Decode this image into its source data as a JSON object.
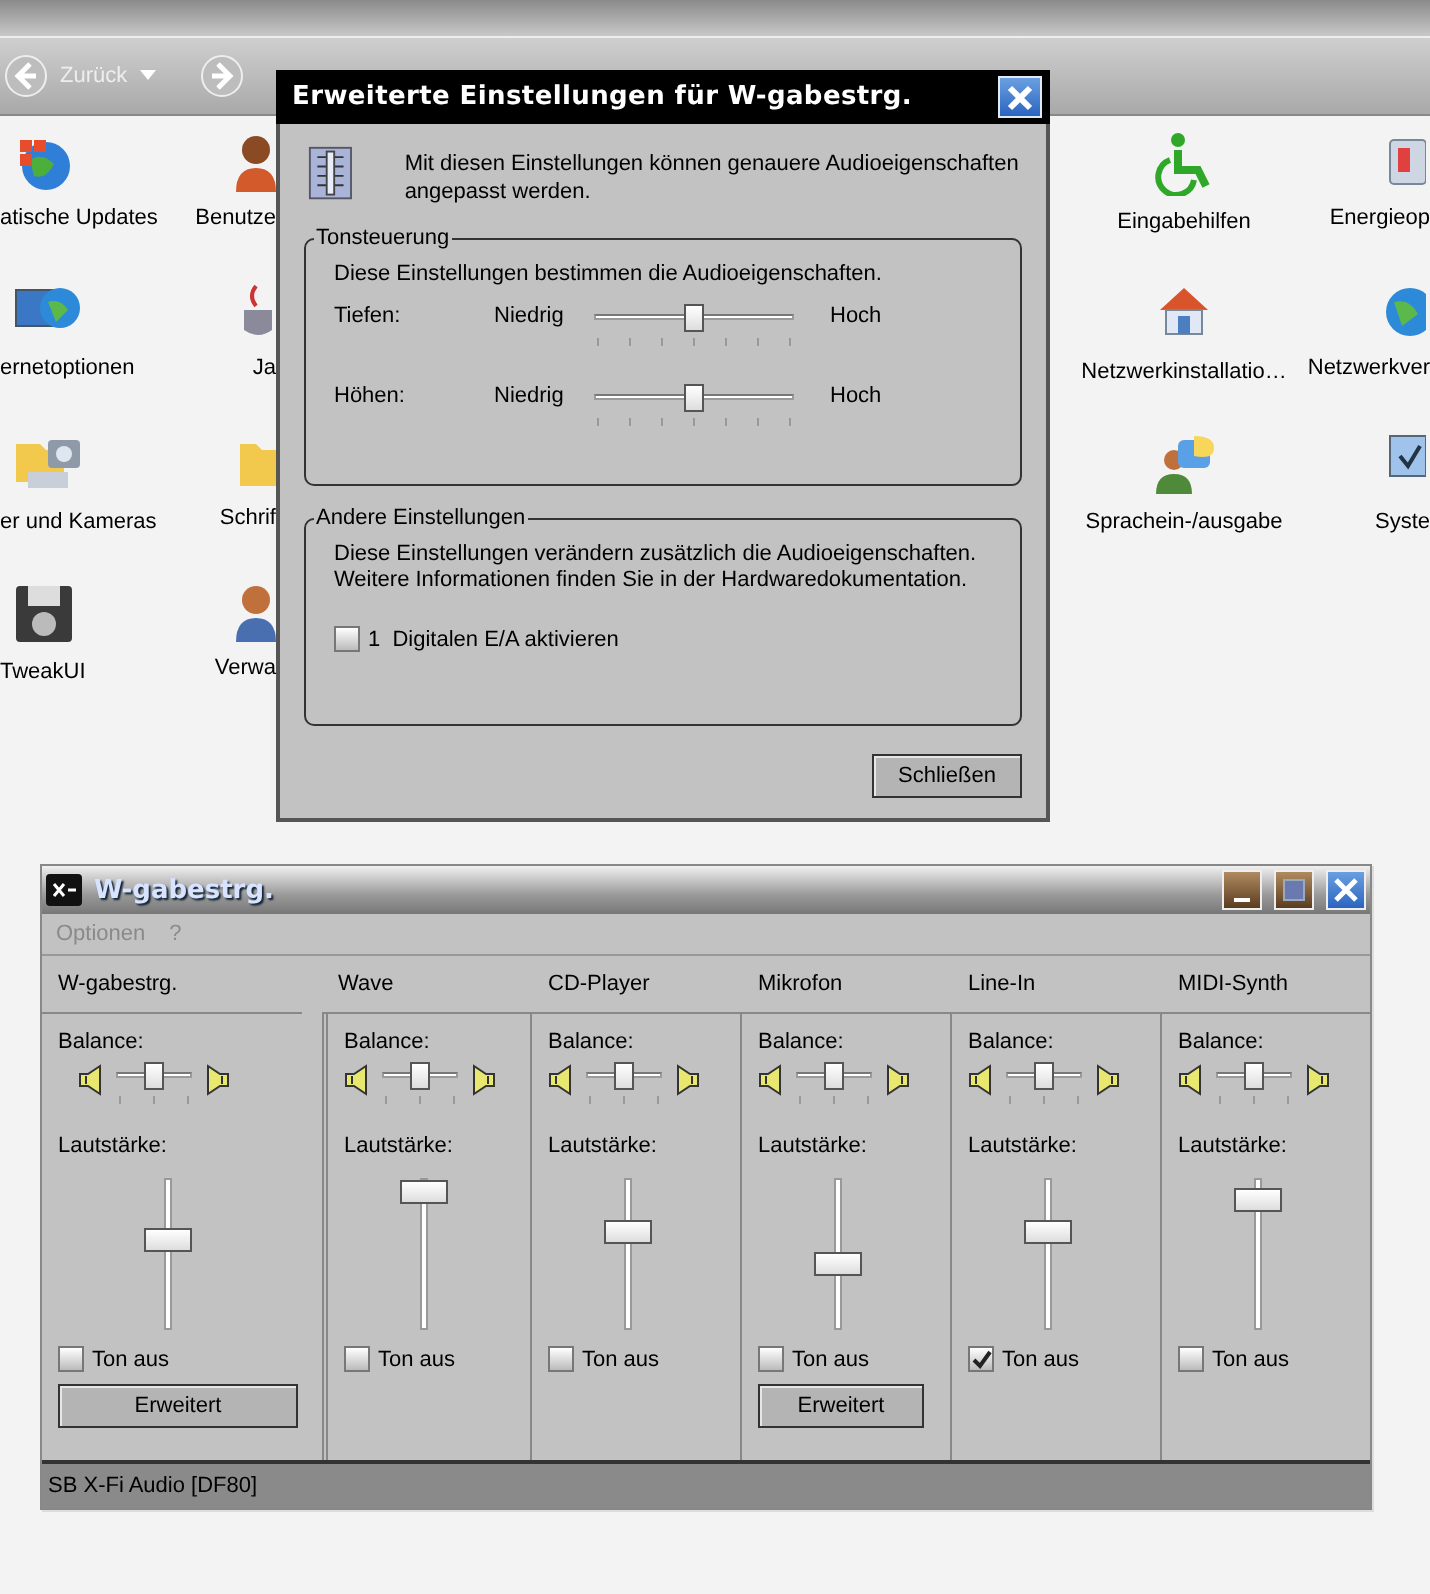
{
  "explorer": {
    "back_label": "Zurück",
    "columns": [
      {
        "items": [
          {
            "label": "atische Updates"
          },
          {
            "label": "ernetoptionen"
          },
          {
            "label": "er und Kameras"
          },
          {
            "label": "TweakUI"
          }
        ]
      },
      {
        "items": [
          {
            "label": "Benutze"
          },
          {
            "label": "Ja"
          },
          {
            "label": "Schrif"
          },
          {
            "label": "Verwa"
          }
        ]
      },
      {
        "items": [
          {
            "label": "Eingabehilfen"
          },
          {
            "label": "Netzwerkinstallatio…"
          },
          {
            "label": "Sprachein-/ausgabe"
          }
        ]
      },
      {
        "items": [
          {
            "label": "Energieop"
          },
          {
            "label": "Netzwerkver"
          },
          {
            "label": "Syste"
          }
        ]
      }
    ]
  },
  "dialog": {
    "title": "Erweiterte Einstellungen für W-gabestrg.",
    "intro": "Mit diesen Einstellungen können genauere Audioeigenschaften angepasst werden.",
    "groups": [
      {
        "title": "Tonsteuerung",
        "description": "Diese Einstellungen bestimmen die Audioeigenschaften.",
        "sliders": [
          {
            "label": "Tiefen:",
            "low": "Niedrig",
            "high": "Hoch",
            "level": 0.5
          },
          {
            "label": "Höhen:",
            "low": "Niedrig",
            "high": "Hoch",
            "level": 0.5
          }
        ]
      },
      {
        "title": "Andere Einstellungen",
        "description": "Diese Einstellungen verändern zusätzlich die Audioeigenschaften.\nWeitere Informationen finden Sie in der Hardwaredokumentation.",
        "checkboxes": [
          {
            "label": "1  Digitalen E/A aktivieren",
            "checked": false
          }
        ]
      }
    ],
    "button": "Schließen"
  },
  "mixer": {
    "title": "W-gabestrg.",
    "menu": [
      "Optionen",
      "?"
    ],
    "channels": [
      {
        "name": "W-gabestrg.",
        "balance_label": "Balance:",
        "balance": {
          "level": 0.5
        },
        "volume_label": "Lautstärke:",
        "volume": {
          "level": 0.6
        },
        "mute": {
          "label": "Ton aus",
          "checked": false
        },
        "button": "Erweitert"
      },
      {
        "name": "Wave",
        "balance_label": "Balance:",
        "balance": {
          "level": 0.5
        },
        "volume_label": "Lautstärke:",
        "volume": {
          "level": 0.97
        },
        "mute": {
          "label": "Ton aus",
          "checked": false
        }
      },
      {
        "name": "CD-Player",
        "balance_label": "Balance:",
        "balance": {
          "level": 0.5
        },
        "volume_label": "Lautstärke:",
        "volume": {
          "level": 0.66
        },
        "mute": {
          "label": "Ton aus",
          "checked": false
        }
      },
      {
        "name": "Mikrofon",
        "balance_label": "Balance:",
        "balance": {
          "level": 0.5
        },
        "volume_label": "Lautstärke:",
        "volume": {
          "level": 0.4
        },
        "mute": {
          "label": "Ton aus",
          "checked": false
        },
        "button": "Erweitert"
      },
      {
        "name": "Line-In",
        "balance_label": "Balance:",
        "balance": {
          "level": 0.5
        },
        "volume_label": "Lautstärke:",
        "volume": {
          "level": 0.66
        },
        "mute": {
          "label": "Ton aus",
          "checked": true
        }
      },
      {
        "name": "MIDI-Synth",
        "balance_label": "Balance:",
        "balance": {
          "level": 0.5
        },
        "volume_label": "Lautstärke:",
        "volume": {
          "level": 0.9
        },
        "mute": {
          "label": "Ton aus",
          "checked": false
        }
      }
    ],
    "status": "SB X-Fi Audio [DF80]"
  }
}
